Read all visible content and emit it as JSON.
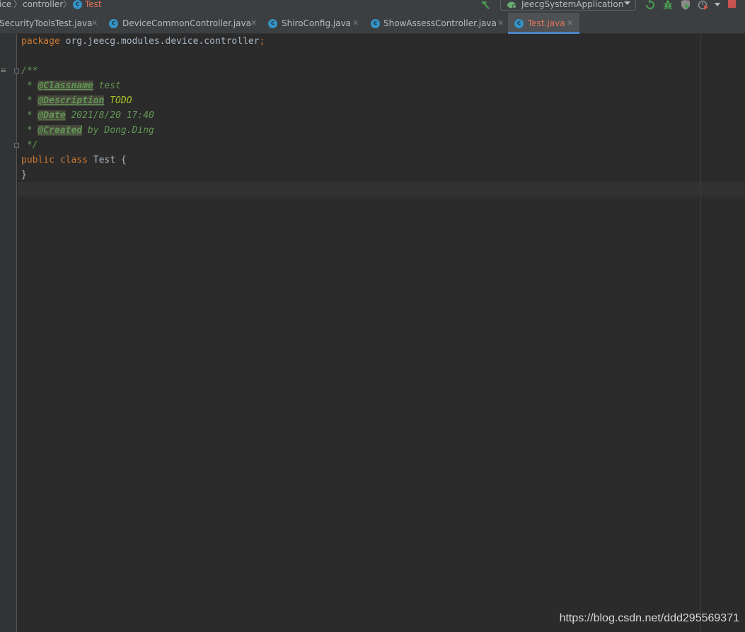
{
  "breadcrumb": {
    "items": [
      "ice",
      "controller",
      "Test"
    ]
  },
  "run_config": {
    "label": "JeecgSystemApplication"
  },
  "tabs": [
    {
      "label": "SecurityToolsTest.java",
      "active": false
    },
    {
      "label": "DeviceCommonController.java",
      "active": false
    },
    {
      "label": "ShiroConfig.java",
      "active": false
    },
    {
      "label": "ShowAssessController.java",
      "active": false
    },
    {
      "label": "Test.java",
      "active": true
    }
  ],
  "code": {
    "package_kw": "package",
    "package_name": "org.jeecg.modules.device.controller",
    "package_semi": ";",
    "doc_open": "/**",
    "doc_lines": [
      {
        "prefix": " * ",
        "tag": "@Classname",
        "text": " test",
        "todo": false
      },
      {
        "prefix": " * ",
        "tag": "@Description",
        "text": " TODO",
        "todo": true
      },
      {
        "prefix": " * ",
        "tag": "@Date",
        "text": " 2021/8/20 17:40",
        "todo": false
      },
      {
        "prefix": " * ",
        "tag": "@Created",
        "text": " by Dong.Ding",
        "todo": false
      }
    ],
    "doc_close": " */",
    "class_kw1": "public",
    "class_kw2": "class",
    "class_name": "Test",
    "class_open": " {",
    "class_close": "}"
  },
  "watermark": "https://blog.csdn.net/ddd295569371",
  "colors": {
    "background": "#2b2b2b",
    "keyword": "#cc7832",
    "doc_comment": "#629755",
    "todo": "#a8c023",
    "active_tab_text": "#e3735a",
    "tab_underline": "#4a88c7",
    "run_green": "#499c54",
    "stop_red": "#c75450"
  }
}
